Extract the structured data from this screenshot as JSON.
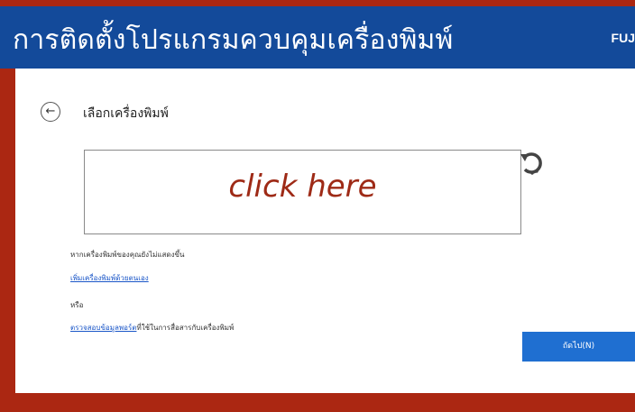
{
  "window": {
    "title": "การติดตั้งโปรแกรมควบคุมเครื่องพิมพ์",
    "brand": "FUJ"
  },
  "page": {
    "heading": "เลือกเครื่องพิมพ์",
    "overlay_text": "click here"
  },
  "help": {
    "not_shown_text": "หากเครื่องพิมพ์ของคุณยังไม่แสดงขึ้น",
    "add_link": "เพิ่มเครื่องพิมพ์ด้วยตนเอง",
    "or_text": "หรือ",
    "check_link": "ตรวจสอบข้อมูลพอร์ต",
    "check_suffix": "ที่ใช้ในการสื่อสารกับเครื่องพิมพ์"
  },
  "buttons": {
    "next_label": "ถัดไป(N)"
  },
  "icons": {
    "back": "back-arrow-icon",
    "refresh": "refresh-icon"
  },
  "colors": {
    "frame": "#ab2712",
    "titlebar": "#134a9a",
    "primary_button": "#1f6fd1",
    "overlay_text": "#9e2a16"
  }
}
